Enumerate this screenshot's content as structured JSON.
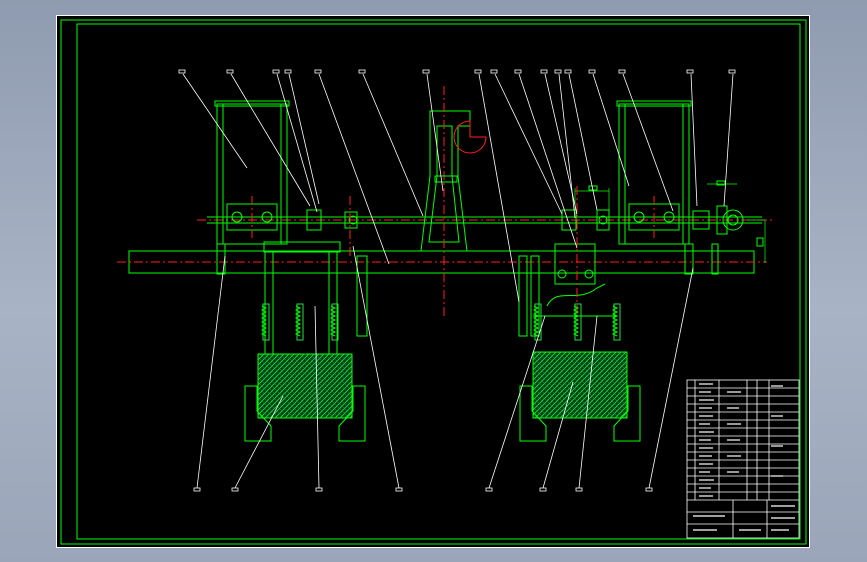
{
  "drawing": {
    "background": "#000000",
    "line_color": "#00ff00",
    "centerline_color": "#ff2020",
    "leader_color": "#ffffff",
    "hatch_color": "#00c840"
  },
  "title_block": {
    "visible_text": []
  }
}
